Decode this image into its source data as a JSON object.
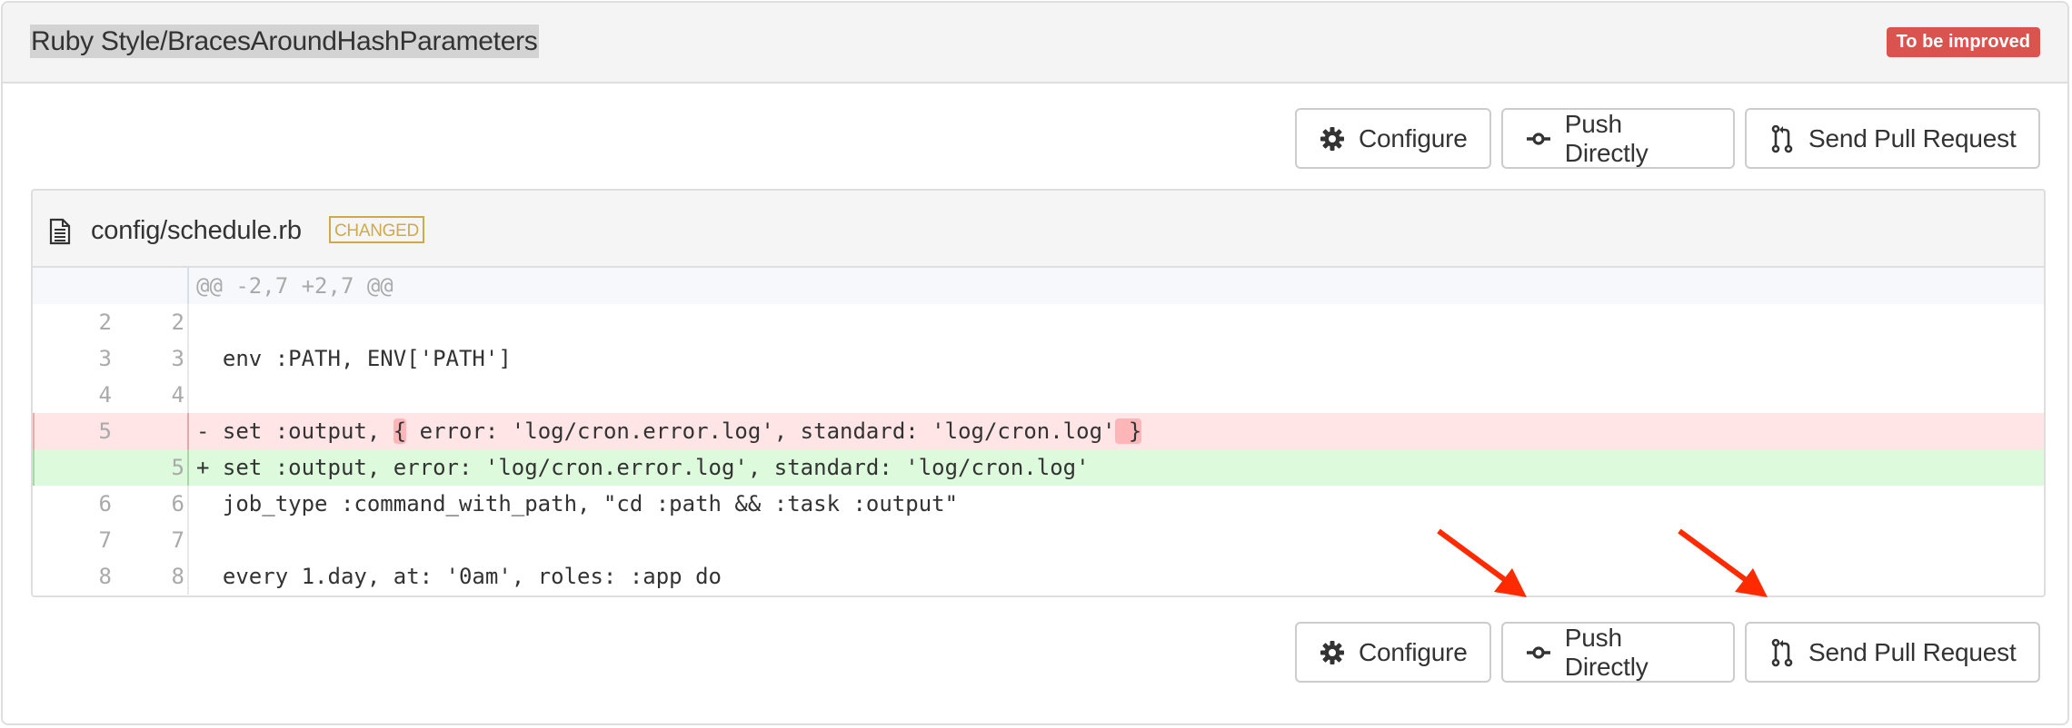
{
  "header": {
    "rule_title": "Ruby Style/BracesAroundHashParameters",
    "status_badge": "To be improved",
    "status_color": "#d9534f"
  },
  "actions": {
    "configure_label": "Configure",
    "configure_icon": "gear-icon",
    "push_label": "Push Directly",
    "push_icon": "git-commit-icon",
    "pr_label": "Send Pull Request",
    "pr_icon": "git-pull-request-icon"
  },
  "file": {
    "icon": "file-text-icon",
    "name": "config/schedule.rb",
    "tag": "CHANGED",
    "tag_color": "#cfaa47",
    "hunk_header": "@@ -2,7 +2,7 @@",
    "lines": [
      {
        "type": "context",
        "old": "2",
        "new": "2",
        "code": ""
      },
      {
        "type": "context",
        "old": "3",
        "new": "3",
        "code": "  env :PATH, ENV['PATH']"
      },
      {
        "type": "context",
        "old": "4",
        "new": "4",
        "code": ""
      },
      {
        "type": "deletion",
        "old": "5",
        "new": "",
        "prefix": "- set :output, ",
        "hl1": "{",
        "middle": " error: 'log/cron.error.log', standard: 'log/cron.log'",
        "hl2": " }"
      },
      {
        "type": "addition",
        "old": "",
        "new": "5",
        "code": "+ set :output, error: 'log/cron.error.log', standard: 'log/cron.log'"
      },
      {
        "type": "context",
        "old": "6",
        "new": "6",
        "code": "  job_type :command_with_path, \"cd :path && :task :output\""
      },
      {
        "type": "context",
        "old": "7",
        "new": "7",
        "code": ""
      },
      {
        "type": "context",
        "old": "8",
        "new": "8",
        "code": "  every 1.day, at: '0am', roles: :app do"
      }
    ]
  },
  "annotations": {
    "arrow_color": "#ff2a00",
    "arrows_point_to": [
      "push-directly-button-bottom",
      "send-pull-request-button-bottom"
    ]
  }
}
